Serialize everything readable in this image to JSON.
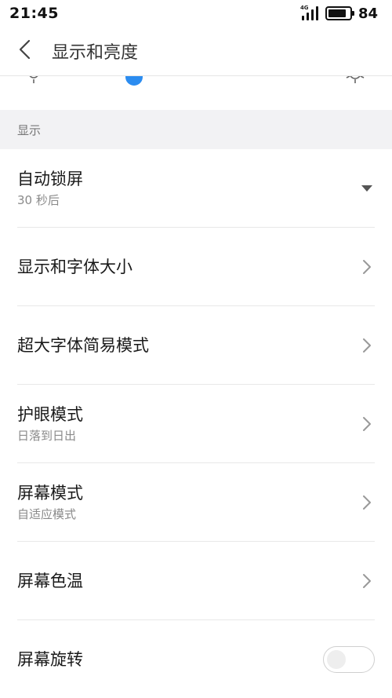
{
  "status_bar": {
    "time": "21:45",
    "network": "4G",
    "battery": "84",
    "battery_level": 0.84
  },
  "header": {
    "title": "显示和亮度",
    "back_icon": "chevron-left-icon"
  },
  "section": {
    "label": "显示"
  },
  "items": [
    {
      "title": "自动锁屏",
      "subtitle": "30 秒后",
      "control": "dropdown"
    },
    {
      "title": "显示和字体大小",
      "subtitle": "",
      "control": "chevron"
    },
    {
      "title": "超大字体简易模式",
      "subtitle": "",
      "control": "chevron"
    },
    {
      "title": "护眼模式",
      "subtitle": "日落到日出",
      "control": "chevron"
    },
    {
      "title": "屏幕模式",
      "subtitle": "自适应模式",
      "control": "chevron"
    },
    {
      "title": "屏幕色温",
      "subtitle": "",
      "control": "chevron"
    },
    {
      "title": "屏幕旋转",
      "subtitle": "",
      "control": "toggle",
      "toggle_on": false
    }
  ],
  "colors": {
    "accent": "#2b8cf0",
    "section_bg": "#f2f2f4",
    "divider": "#e8e8e8"
  }
}
